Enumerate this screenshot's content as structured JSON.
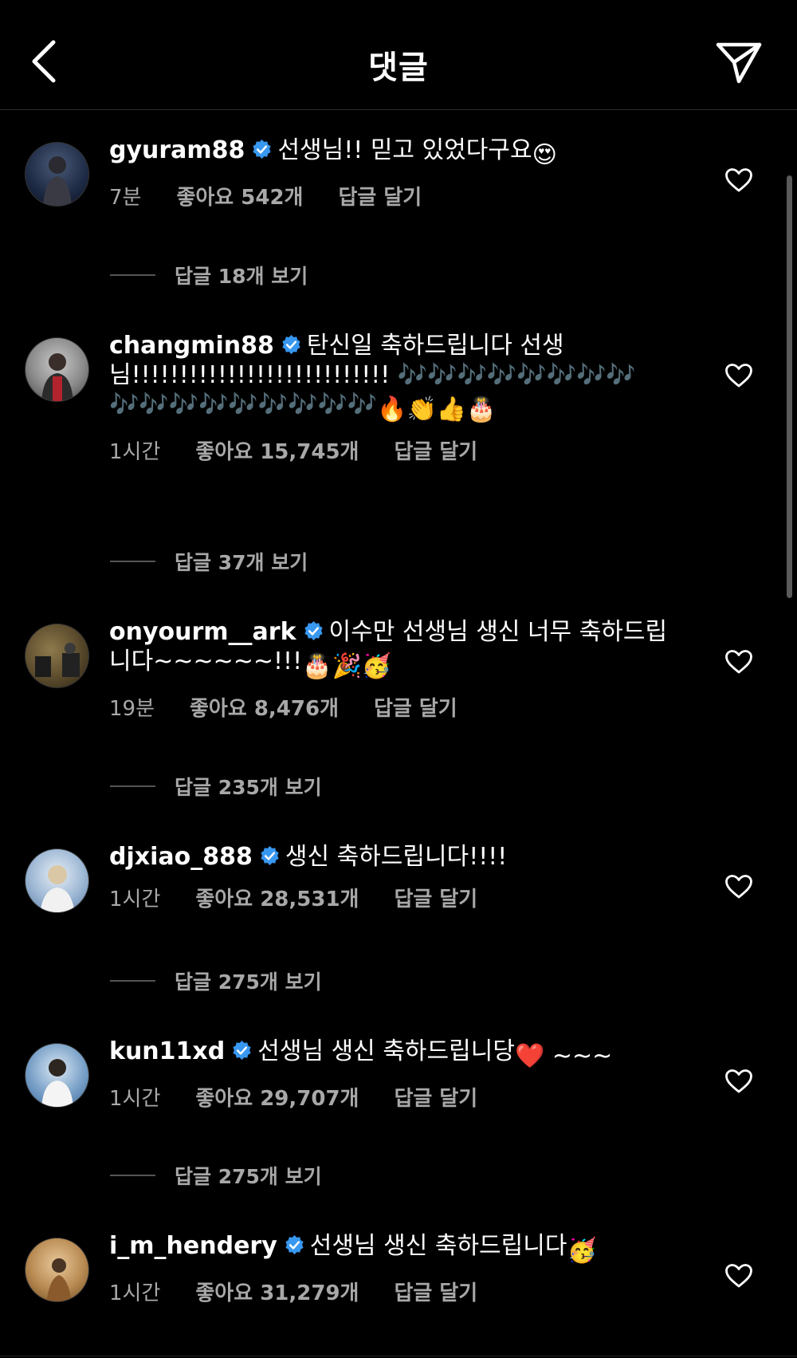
{
  "header": {
    "title": "댓글",
    "back_icon": "chevron-left-icon",
    "share_icon": "paper-plane-icon"
  },
  "colors": {
    "background": "#000000",
    "text": "#ffffff",
    "meta": "#a8a8a8",
    "verified": "#3897f0"
  },
  "comments": [
    {
      "username": "gyuram88",
      "text": "선생님!! 믿고 있었다구요",
      "emoji": "😍",
      "time": "7분",
      "likes": "좋아요 542개",
      "reply": "답글 달기",
      "view_replies": "답글 18개 보기"
    },
    {
      "username": "changmin88",
      "text": "탄신일 축하드립니다 선생님!!!!!!!!!!!!!!!!!!!!!!!!!!! 🎶🎶🎶🎶🎶🎶🎶🎶🎶🎶🎶🎶🎶🎶🎶🎶🎶",
      "emoji": "🔥👏👍🎂",
      "time": "1시간",
      "likes": "좋아요 15,745개",
      "reply": "답글 달기",
      "view_replies": "답글 37개 보기"
    },
    {
      "username": "onyourm__ark",
      "text": "이수만 선생님 생신 너무 축하드립니다~~~~~~!!!",
      "emoji": "🎂🎉🥳",
      "time": "19분",
      "likes": "좋아요 8,476개",
      "reply": "답글 달기",
      "view_replies": "답글 235개 보기"
    },
    {
      "username": "djxiao_888",
      "text": "생신 축하드립니다!!!!",
      "emoji": "",
      "time": "1시간",
      "likes": "좋아요 28,531개",
      "reply": "답글 달기",
      "view_replies": "답글 275개 보기"
    },
    {
      "username": "kun11xd",
      "text": "선생님 생신 축하드립니당",
      "emoji": " ❤️ ~~~",
      "time": "1시간",
      "likes": "좋아요 29,707개",
      "reply": "답글 달기",
      "view_replies": "답글 275개 보기"
    },
    {
      "username": "i_m_hendery",
      "text": "선생님 생신 축하드립니다",
      "emoji": "🥳",
      "time": "1시간",
      "likes": "좋아요 31,279개",
      "reply": "답글 달기",
      "view_replies": ""
    }
  ]
}
